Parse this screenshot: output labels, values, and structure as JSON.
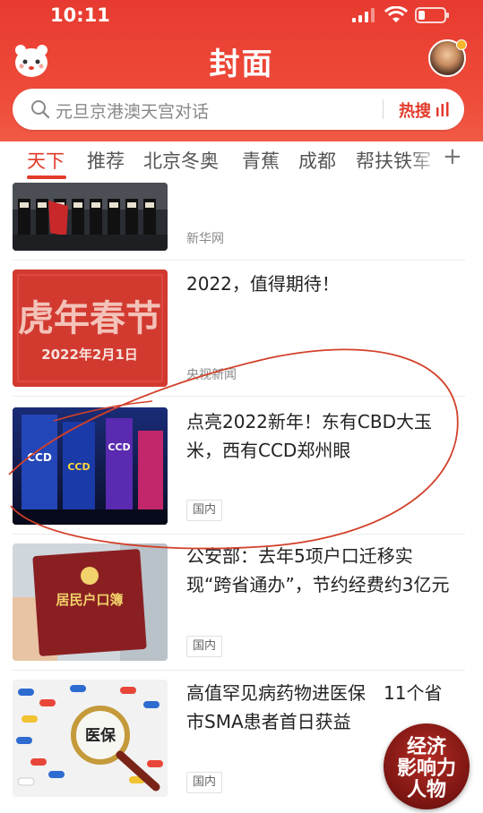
{
  "status_bar": {
    "time": "10:11"
  },
  "header": {
    "brand": "封面",
    "search": {
      "placeholder": "元旦京港澳天宫对话",
      "hot_label": "热搜"
    }
  },
  "tabs": [
    {
      "label": "天下",
      "active": true
    },
    {
      "label": "推荐"
    },
    {
      "label": "北京冬奥"
    },
    {
      "label": "青蕉"
    },
    {
      "label": "成都"
    },
    {
      "label": "帮扶铁军"
    }
  ],
  "tabs_more": "+",
  "feed": [
    {
      "source": "新华网"
    },
    {
      "title": "2022，值得期待！",
      "source": "央视新闻",
      "thumb_text": [
        "虎年春节",
        "2022年2月1日"
      ]
    },
    {
      "title": "点亮2022新年！东有CBD大玉米，西有CCD郑州眼",
      "tag": "国内"
    },
    {
      "title": "公安部：去年5项户口迁移实现“跨省通办”，节约经费约3亿元",
      "tag": "国内",
      "thumb_text": [
        "居民户口簿"
      ]
    },
    {
      "title": "高值罕见病药物进医保　11个省市SMA患者首日获益",
      "tag": "国内",
      "thumb_text": [
        "医保"
      ]
    }
  ],
  "float_badge": [
    "经济",
    "影响力",
    "人物"
  ],
  "colors": {
    "brand_red": "#e23b2c",
    "header_red": "#e83a30"
  }
}
